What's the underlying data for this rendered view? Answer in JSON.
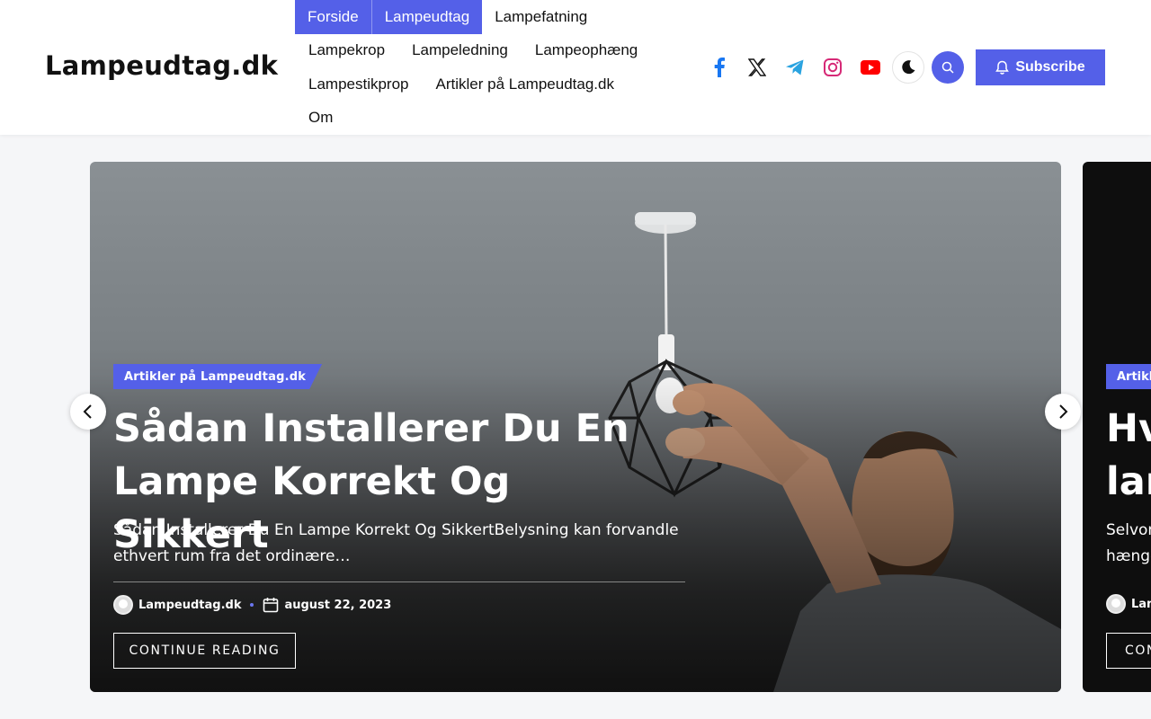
{
  "site": {
    "title": "Lampeudtag.dk"
  },
  "nav": {
    "rows": [
      [
        "Forside",
        "Lampeudtag",
        "Lampefatning"
      ],
      [
        "Lampekrop",
        "Lampeledning",
        "Lampeophæng"
      ],
      [
        "Lampestikprop",
        "Artikler på Lampeudtag.dk"
      ],
      [
        "Om"
      ]
    ]
  },
  "socials": [
    "facebook-icon",
    "x-icon",
    "telegram-icon",
    "instagram-icon",
    "youtube-icon"
  ],
  "header": {
    "subscribe_label": "Subscribe"
  },
  "colors": {
    "accent": "#5460e8",
    "facebook": "#1877f2",
    "telegram": "#2aa3e0",
    "instagram": "#d62976",
    "youtube": "#ff0000"
  },
  "slides": [
    {
      "category": "Artikler på Lampeudtag.dk",
      "title": "Sådan Installerer Du En Lampe Korrekt Og Sikkert",
      "excerpt": "Sådan Installerer Du En Lampe Korrekt Og SikkertBelysning kan forvandle ethvert rum fra det ordinære…",
      "author": "Lampeudtag.dk",
      "date": "august 22, 2023",
      "cta": "CONTINUE READING"
    },
    {
      "category": "Artikl",
      "title_line1": "Hv",
      "title_line2": "lan",
      "excerpt_line1": "Selvom",
      "excerpt_line2": "hænge",
      "author": "Lam",
      "cta": "CON"
    }
  ]
}
